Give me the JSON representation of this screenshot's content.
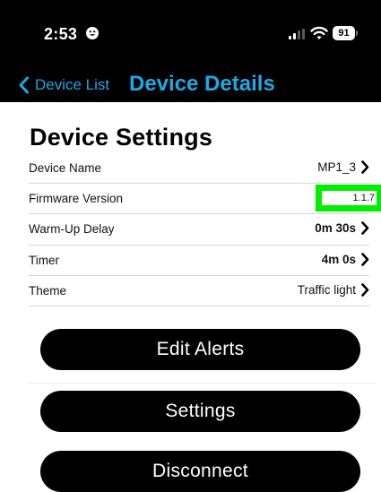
{
  "status_bar": {
    "time": "2:53",
    "battery": "91",
    "icons": [
      "face-icon",
      "signal-icon",
      "wifi-icon",
      "battery-icon"
    ]
  },
  "nav": {
    "back_label": "Device List",
    "title": "Device Details",
    "accent_color": "#1ea7e6"
  },
  "section_title": "Device Settings",
  "settings": {
    "device_name": {
      "label": "Device Name",
      "value": "MP1_3"
    },
    "firmware": {
      "label": "Firmware Version",
      "value": "1.1.7",
      "highlight_color": "#00ee00"
    },
    "warmup": {
      "label": "Warm-Up Delay",
      "value": "0m 30s"
    },
    "timer": {
      "label": "Timer",
      "value": "4m 0s"
    },
    "theme": {
      "label": "Theme",
      "value": "Traffic light"
    }
  },
  "buttons": {
    "edit_alerts": "Edit Alerts",
    "settings": "Settings",
    "disconnect": "Disconnect"
  }
}
